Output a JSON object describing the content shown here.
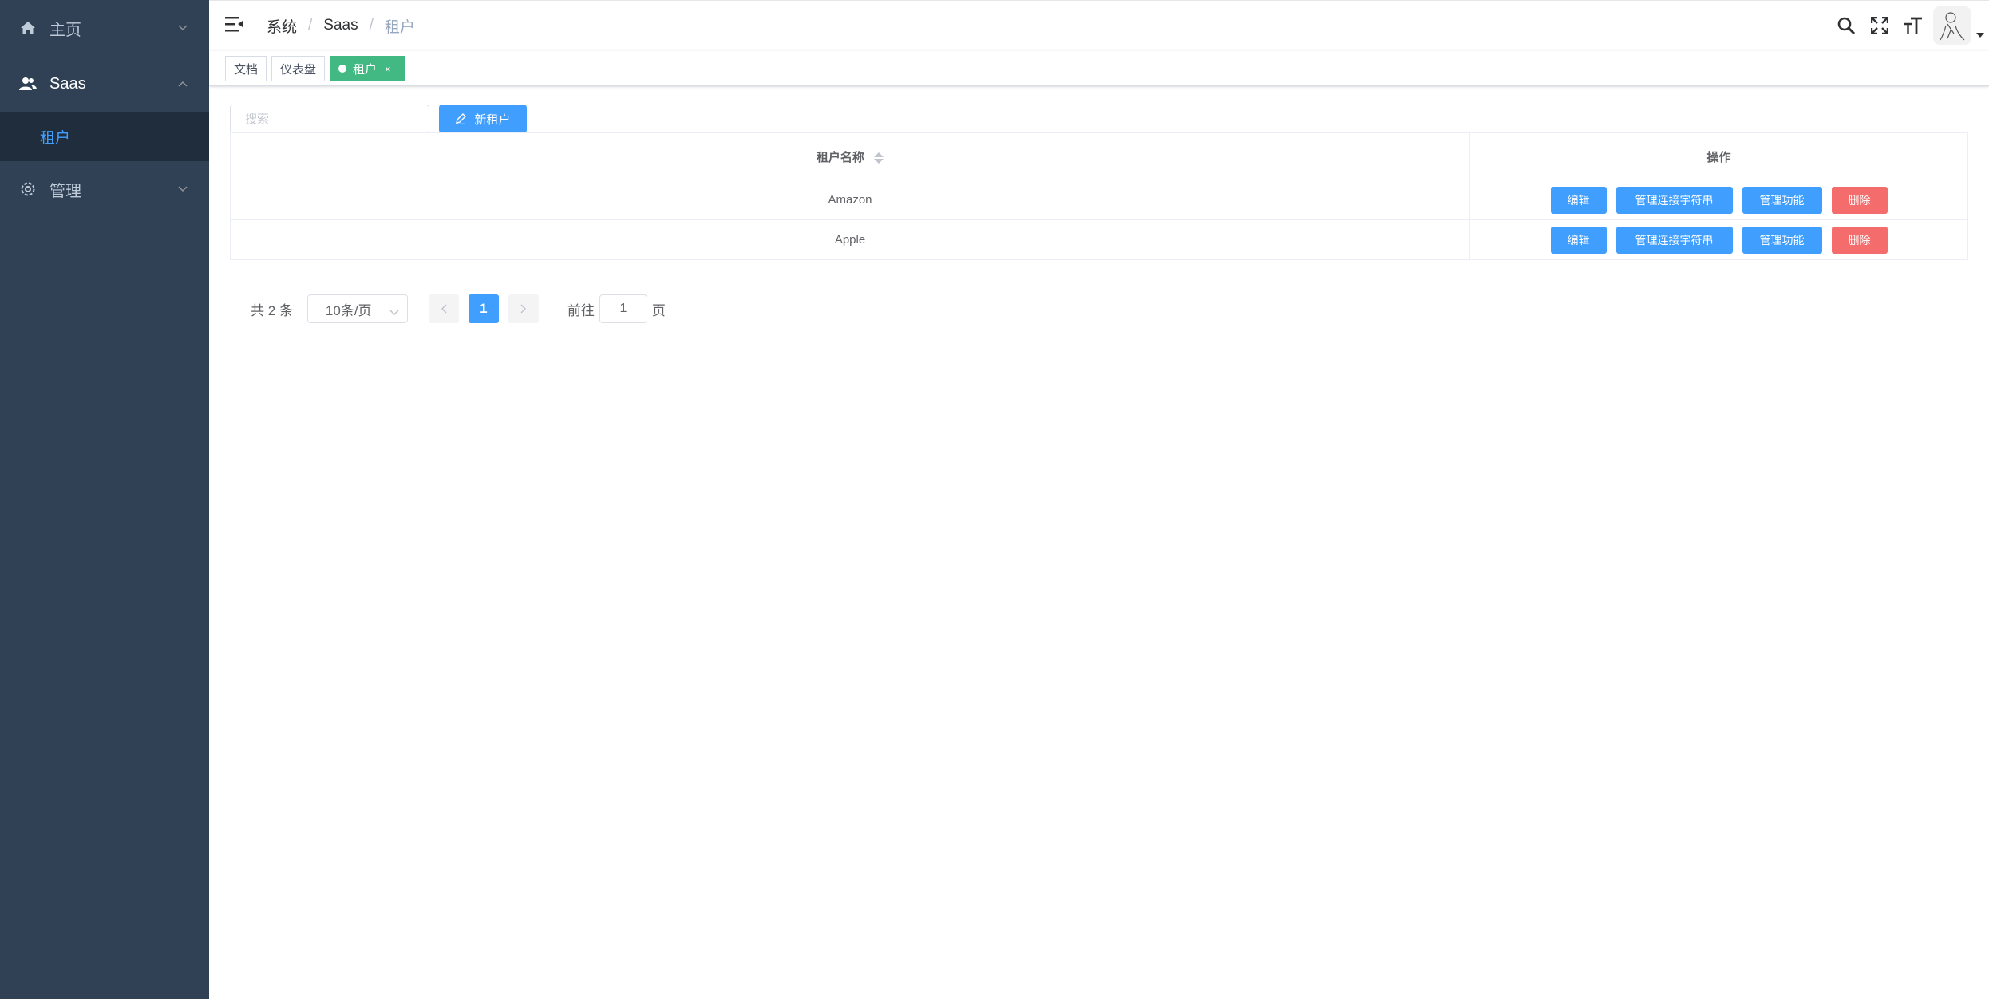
{
  "sidebar": {
    "items": [
      {
        "label": "主页",
        "icon": "home-icon"
      },
      {
        "label": "Saas",
        "icon": "users-icon",
        "children": [
          {
            "label": "租户"
          }
        ]
      },
      {
        "label": "管理",
        "icon": "gear-icon"
      }
    ]
  },
  "navbar": {
    "breadcrumb": [
      "系统",
      "Saas",
      "租户"
    ],
    "right_icons": [
      "search-icon",
      "fullscreen-icon",
      "font-size-icon"
    ]
  },
  "tags": [
    {
      "label": "文档"
    },
    {
      "label": "仪表盘"
    },
    {
      "label": "租户",
      "active": true,
      "close": "×"
    }
  ],
  "toolbar": {
    "search_placeholder": "搜索",
    "search_value": "",
    "new_label": "新租户"
  },
  "table": {
    "columns": [
      "租户名称",
      "操作"
    ],
    "rows": [
      {
        "name": "Amazon"
      },
      {
        "name": "Apple"
      }
    ],
    "actions": {
      "edit": "编辑",
      "conn": "管理连接字符串",
      "feature": "管理功能",
      "delete": "删除"
    }
  },
  "pagination": {
    "total": "共 2 条",
    "page_size": "10条/页",
    "current_page": "1",
    "goto_prefix": "前往",
    "goto_value": "1",
    "goto_suffix": "页"
  },
  "colors": {
    "sidebar_bg": "#304156",
    "primary": "#409eff",
    "danger": "#f56c6c",
    "active_tag": "#42b983"
  }
}
